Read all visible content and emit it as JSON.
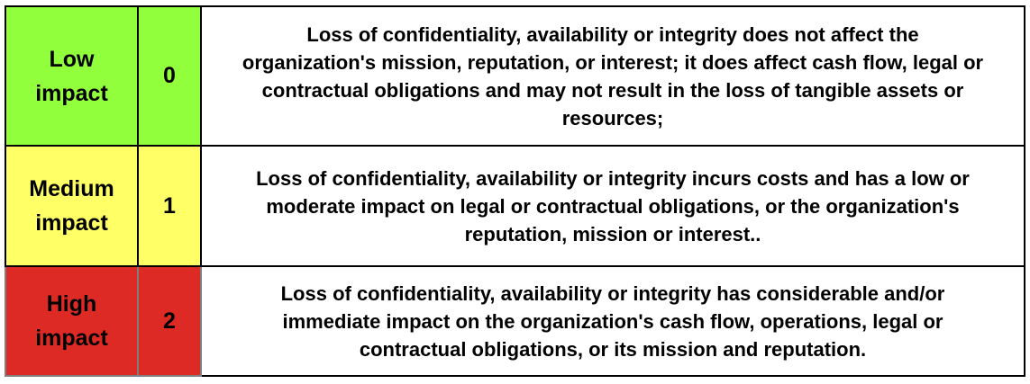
{
  "rows": [
    {
      "level_line1": "Low",
      "level_line2": "impact",
      "score": "0",
      "description": "Loss of confidentiality, availability or integrity does not affect the organization's mission, reputation, or interest; it does affect cash flow, legal or contractual obligations and may not result in the loss of tangible assets or resources;",
      "color": "#92ff3c"
    },
    {
      "level_line1": "Medium",
      "level_line2": "impact",
      "score": "1",
      "description": "Loss of confidentiality, availability or integrity incurs costs and has a low or moderate impact on legal or contractual obligations, or the organization's reputation, mission or interest..",
      "color": "#ffff66"
    },
    {
      "level_line1": "High",
      "level_line2": "impact",
      "score": "2",
      "description": "Loss of confidentiality, availability or integrity has considerable and/or immediate impact on the organization's cash flow, operations, legal or contractual obligations, or its mission and reputation.",
      "color": "#de2a24"
    }
  ]
}
